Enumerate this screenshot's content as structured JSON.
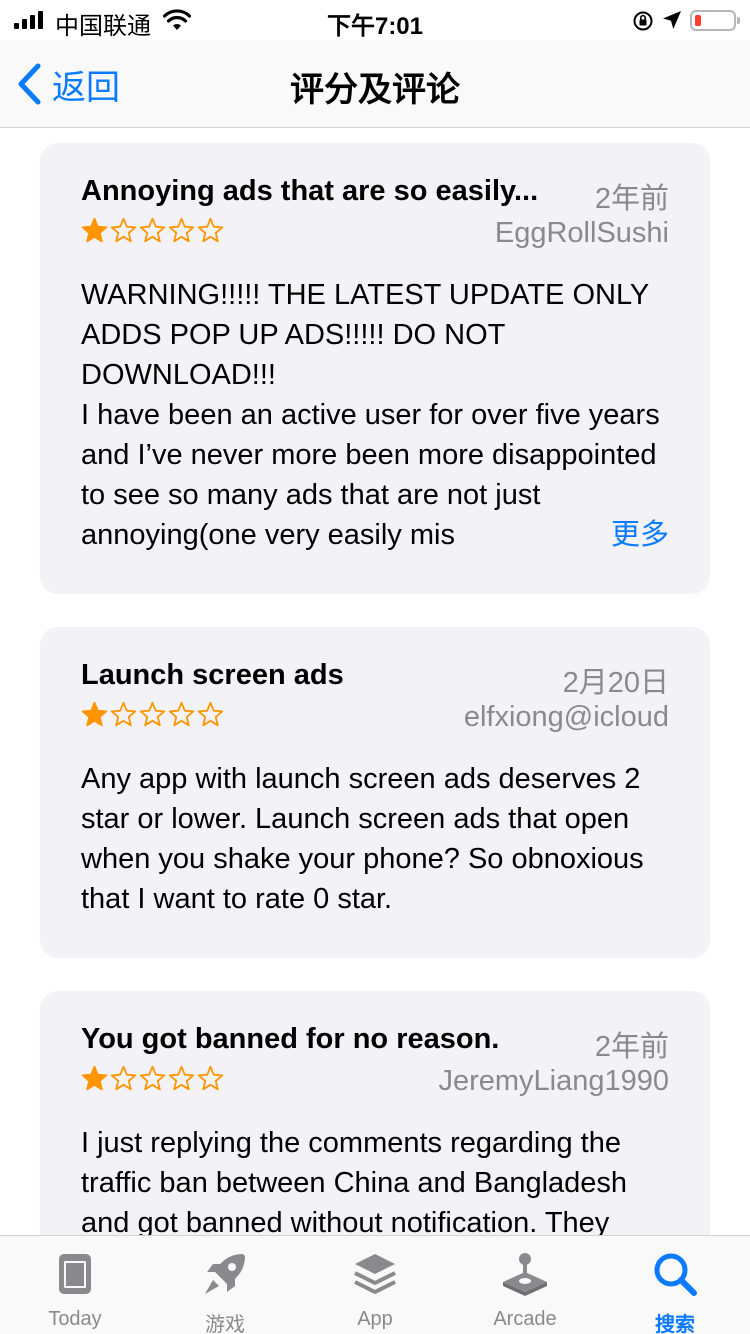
{
  "status_bar": {
    "carrier": "中国联通",
    "time": "下午7:01"
  },
  "nav": {
    "back_label": "返回",
    "title": "评分及评论"
  },
  "reviews": [
    {
      "title": "Annoying ads that are so easily...",
      "date": "2年前",
      "rating": 1,
      "max_rating": 5,
      "author": "EggRollSushi",
      "body": "WARNING!!!!! THE LATEST UPDATE ONLY ADDS POP UP ADS!!!!! DO NOT DOWNLOAD!!!\nI have been an active user for over five years and I’ve never more been more disappointed to see so many ads that are not just annoying(one very easily mis",
      "more_label": "更多"
    },
    {
      "title": "Launch screen ads",
      "date": "2月20日",
      "rating": 1,
      "max_rating": 5,
      "author": "elfxiong@icloud",
      "body": "Any app with launch screen ads deserves 2 star or lower. Launch screen ads that open when you shake your phone? So obnoxious that I want to rate 0 star."
    },
    {
      "title": "You got banned for no reason.",
      "date": "2年前",
      "rating": 1,
      "max_rating": 5,
      "author": "JeremyLiang1990",
      "body": "I just replying the comments regarding the traffic ban between China and Bangladesh and got banned without notification. They"
    }
  ],
  "tabs": [
    {
      "label": "Today",
      "icon": "today-icon",
      "active": false
    },
    {
      "label": "游戏",
      "icon": "rocket-icon",
      "active": false
    },
    {
      "label": "App",
      "icon": "app-stack-icon",
      "active": false
    },
    {
      "label": "Arcade",
      "icon": "joystick-icon",
      "active": false
    },
    {
      "label": "搜索",
      "icon": "search-icon",
      "active": true
    }
  ],
  "colors": {
    "accent": "#0a7aff",
    "star": "#ff9500",
    "secondary_text": "#8a8a8e",
    "card_bg": "#f2f2f7",
    "battery_low": "#ff3b30"
  }
}
